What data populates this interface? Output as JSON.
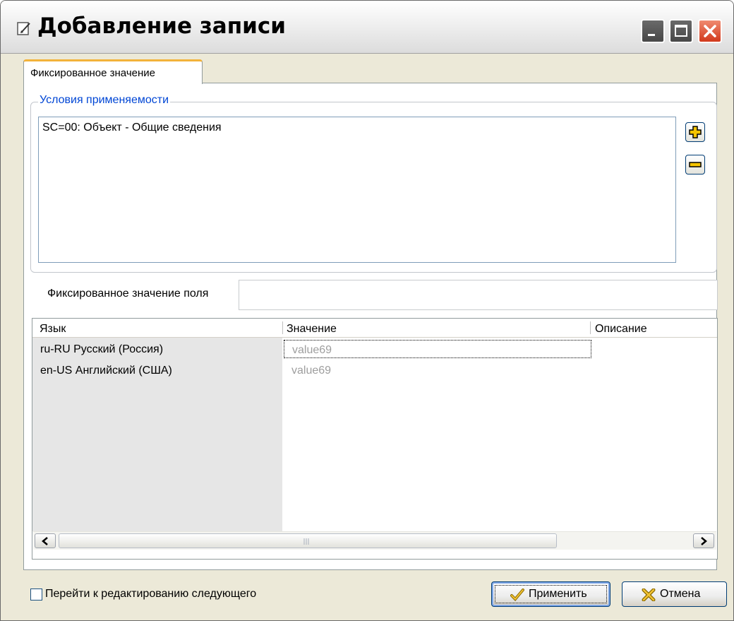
{
  "window": {
    "title": "Добавление записи"
  },
  "tabs": [
    {
      "label": "Фиксированное значение"
    }
  ],
  "conditions": {
    "legend": "Условия применяемости",
    "items": [
      "SC=00: Объект - Общие сведения"
    ]
  },
  "fixed_field": {
    "label": "Фиксированное значение поля",
    "value": ""
  },
  "grid": {
    "columns": [
      "Язык",
      "Значение",
      "Описание"
    ],
    "rows": [
      {
        "lang": "ru-RU  Русский (Россия)",
        "value": "value69",
        "description": ""
      },
      {
        "lang": "en-US  Английский (США)",
        "value": "value69",
        "description": ""
      }
    ]
  },
  "footer": {
    "checkbox_label": "Перейти к редактированию следующего",
    "apply_label": "Применить",
    "cancel_label": "Отмена"
  }
}
